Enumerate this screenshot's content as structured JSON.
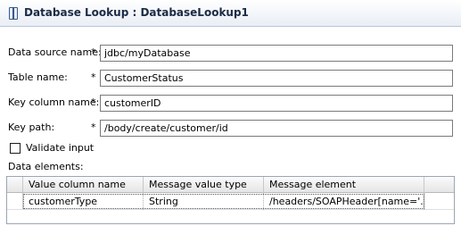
{
  "window": {
    "title": "Database Lookup : DatabaseLookup1"
  },
  "form": {
    "fields": [
      {
        "label": "Data source name:",
        "required": "*",
        "value": "jdbc/myDatabase"
      },
      {
        "label": "Table name:",
        "required": "*",
        "value": "CustomerStatus"
      },
      {
        "label": "Key column name:",
        "required": "*",
        "value": "customerID"
      },
      {
        "label": "Key path:",
        "required": "*",
        "value": "/body/create/customer/id"
      }
    ],
    "validate_label": "Validate input",
    "validate_checked": false,
    "data_elements_label": "Data elements:"
  },
  "table": {
    "headers": [
      "Value column name",
      "Message value type",
      "Message element"
    ],
    "rows": [
      [
        "customerType",
        "String",
        "/headers/SOAPHeader[name='..."
      ]
    ]
  }
}
